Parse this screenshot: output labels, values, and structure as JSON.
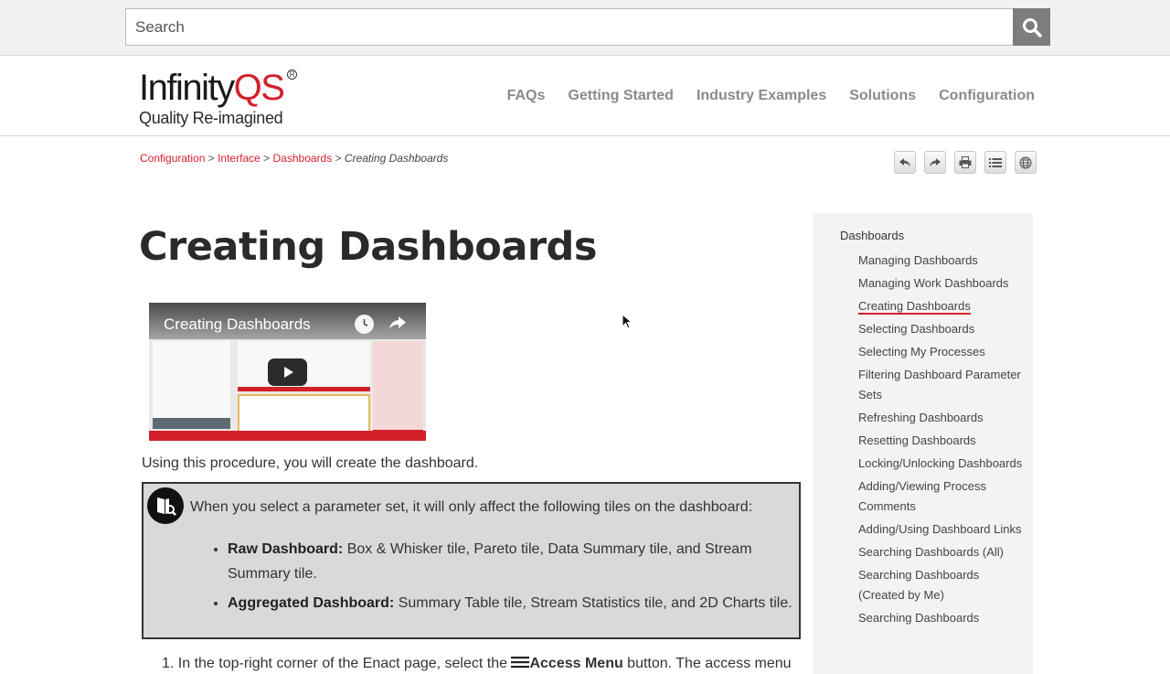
{
  "search": {
    "placeholder": "Search"
  },
  "logo": {
    "name_a": "Infinity",
    "name_b": "QS",
    "reg": "R",
    "tagline": "Quality Re-imagined"
  },
  "nav": [
    "FAQs",
    "Getting Started",
    "Industry Examples",
    "Solutions",
    "Configuration"
  ],
  "breadcrumb": {
    "items": [
      "Configuration",
      "Interface",
      "Dashboards"
    ],
    "current": "Creating Dashboards",
    "sep": ">"
  },
  "page": {
    "title": "Creating Dashboards",
    "video_title": "Creating Dashboards",
    "intro": "Using this procedure, you will create the dashboard."
  },
  "note": {
    "lead": "When you select a parameter set, it will only affect the following tiles on the dashboard:",
    "items": [
      {
        "label": "Raw Dashboard:",
        "text": " Box & Whisker tile, Pareto tile, Data Summary tile, and Stream Summary tile."
      },
      {
        "label": "Aggregated Dashboard:",
        "text": " Summary Table tile, Stream Statistics tile, and 2D Charts tile."
      }
    ]
  },
  "steps": [
    {
      "num": "1.",
      "pre": "In the top-right corner of the Enact page, select the ",
      "bold": "Access Menu",
      "post": " button. The access menu"
    }
  ],
  "toc": {
    "head": "Dashboards",
    "items": [
      "Managing Dashboards",
      "Managing Work Dashboards",
      "Creating Dashboards",
      "Selecting Dashboards",
      "Selecting My Processes",
      "Filtering Dashboard Parameter Sets",
      "Refreshing Dashboards",
      "Resetting Dashboards",
      "Locking/Unlocking Dashboards",
      "Adding/Viewing Process Comments",
      "Adding/Using Dashboard Links",
      "Searching Dashboards (All)",
      "Searching Dashboards (Created by Me)",
      "Searching Dashboards"
    ],
    "active_index": 2
  },
  "colors": {
    "accent": "#d3202b",
    "nav_text": "#8a8a8a",
    "search_button": "#7d7d7d"
  },
  "icons": [
    "search-icon",
    "back-icon",
    "forward-icon",
    "print-icon",
    "list-icon",
    "globe-icon",
    "play-icon",
    "clock-icon",
    "share-icon",
    "note-icon",
    "menu-icon"
  ]
}
